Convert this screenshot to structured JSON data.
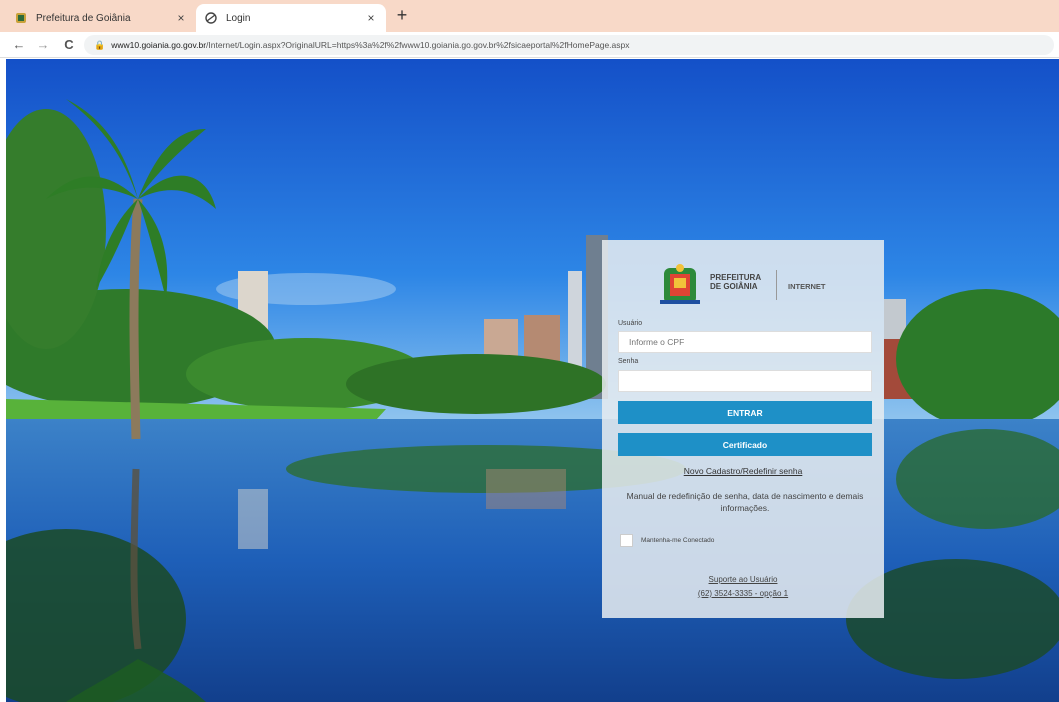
{
  "browser": {
    "tabs": [
      {
        "title": "Prefeitura de Goiânia",
        "active": false
      },
      {
        "title": "Login",
        "active": true
      }
    ],
    "close_glyph": "×",
    "new_tab_glyph": "+",
    "url_domain": "www10.goiania.go.gov.br",
    "url_path": "/Internet/Login.aspx?OriginalURL=https%3a%2f%2fwww10.goiania.go.gov.br%2fsicaeportal%2fHomePage.aspx"
  },
  "login": {
    "logo_line1": "PREFEITURA",
    "logo_line2": "DE GOIÂNIA",
    "logo_tag": "INTERNET",
    "user_label": "Usuário",
    "user_placeholder": "Informe o CPF",
    "password_label": "Senha",
    "password_value": "",
    "enter_button": "ENTRAR",
    "certificate_button": "Certificado",
    "register_link": "Novo Cadastro/Redefinir senha",
    "manual_text": "Manual de redefinição de senha, data de nascimento e demais informações.",
    "remember_label": "Mantenha-me Conectado",
    "support_link": "Suporte ao Usuário",
    "support_phone": "(62) 3524-3335 - opção 1"
  },
  "colors": {
    "tabbar_bg": "#f8d9c8",
    "accent_button": "#1e90c7",
    "sky": "#1f6fe0"
  }
}
